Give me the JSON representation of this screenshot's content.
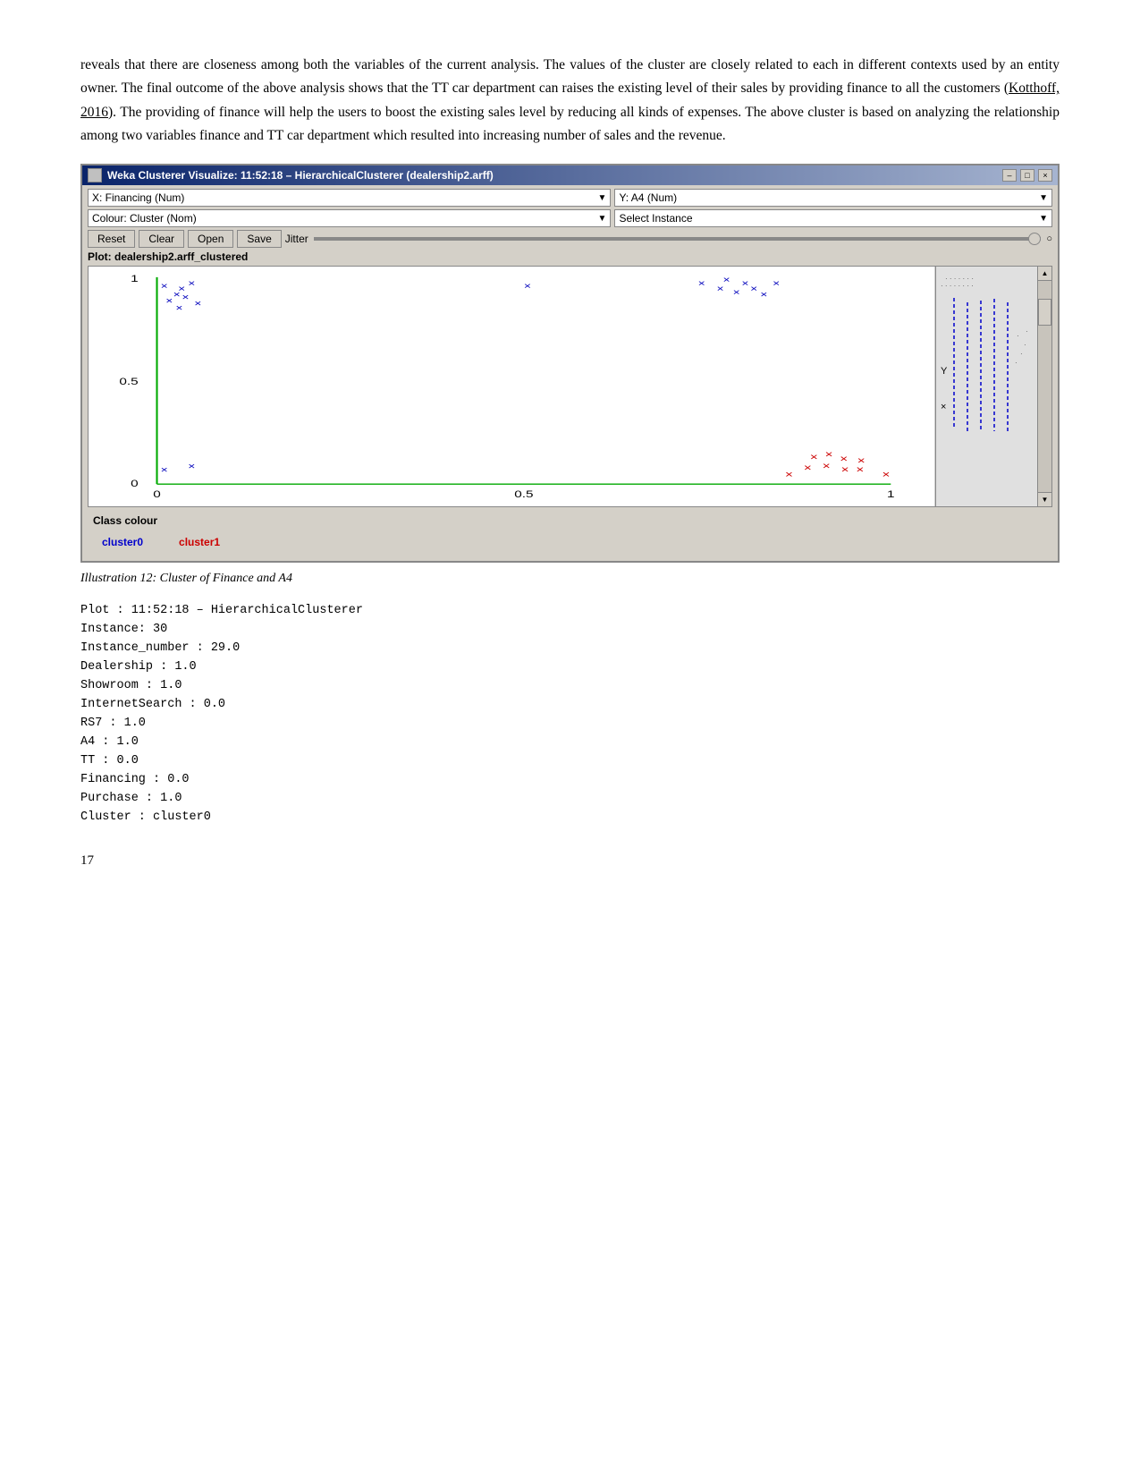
{
  "paragraph": {
    "text1": "reveals that there are closeness among both the variables of the current analysis. The values of the cluster are closely related to each in different contexts used by an entity owner. The final outcome of the above analysis shows that the TT car department can raises the existing level of their sales by providing finance to all the customers (",
    "link": "Kotthoff, 2016",
    "text2": "). The providing of finance will help the users to boost the existing sales level by reducing all kinds of expenses. The above cluster is based on analyzing the relationship among two variables finance and TT car department which resulted into increasing number of sales and the revenue."
  },
  "weka": {
    "title": "Weka Clusterer Visualize: 11:52:18 – HierarchicalClusterer (dealership2.arff)",
    "title_icon": "weka-icon",
    "min_button": "–",
    "max_button": "□",
    "close_button": "×",
    "x_axis_label": "X: Financing (Num)",
    "y_axis_label": "Y: A4 (Num)",
    "colour_label": "Colour: Cluster (Nom)",
    "select_instance_label": "Select Instance",
    "reset_button": "Reset",
    "clear_button": "Clear",
    "open_button": "Open",
    "save_button": "Save",
    "jitter_label": "Jitter",
    "plot_title": "Plot: dealership2.arff_clustered",
    "x_axis_0": "0",
    "x_axis_05": "0.5",
    "x_axis_1": "1",
    "y_axis_0": "0",
    "y_axis_05": "0.5",
    "y_axis_1": "1",
    "class_colour_title": "Class colour",
    "cluster0_label": "cluster0",
    "cluster1_label": "cluster1"
  },
  "caption": "Illustration 12: Cluster of Finance and A4",
  "mono": {
    "line1": "Plot : 11:52:18 – HierarchicalClusterer",
    "line2": "Instance: 30",
    "line3": "Instance_number : 29.0",
    "line4": "     Dealership : 1.0",
    "line5": "       Showroom : 1.0",
    "line6": " InternetSearch : 0.0",
    "line7": "            RS7 : 1.0",
    "line8": "             A4 : 1.0",
    "line9": "             TT : 0.0",
    "line10": "      Financing : 0.0",
    "line11": "       Purchase : 1.0",
    "line12": "        Cluster : cluster0"
  },
  "page_number": "17"
}
